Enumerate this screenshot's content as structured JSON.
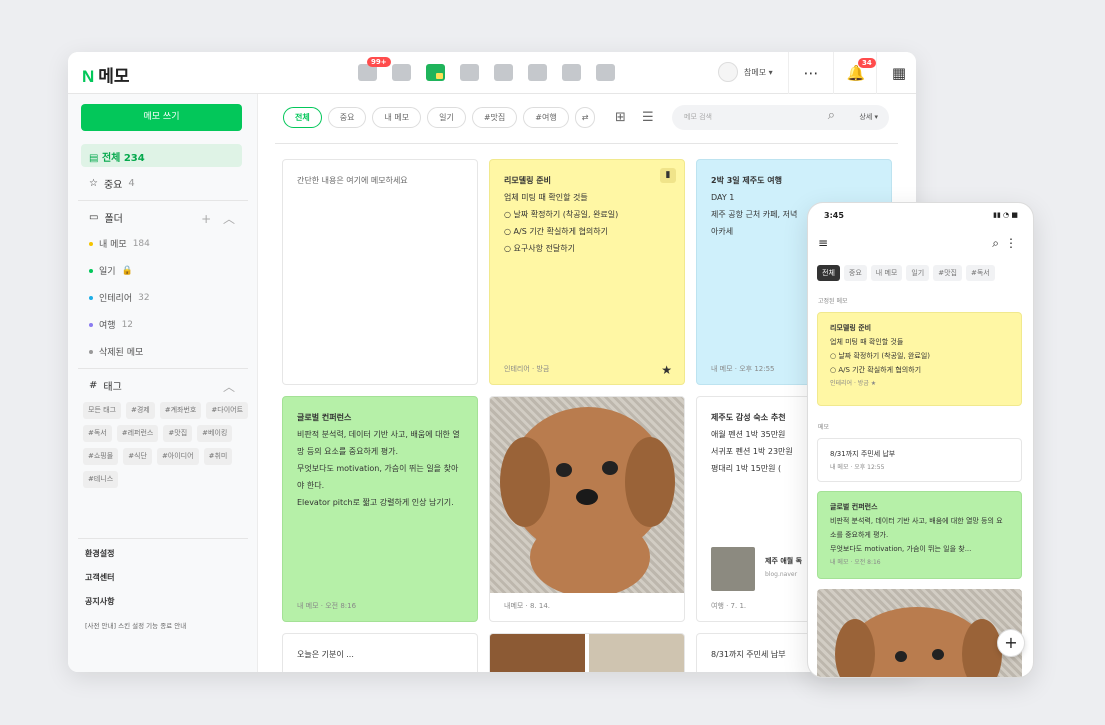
{
  "app": {
    "logo_n": "N",
    "title": "메모"
  },
  "header": {
    "mail_badge": "99+",
    "user_name": "참메모 ▾",
    "talk_icon": "⋯",
    "alarm_badge": "34",
    "grid_icon": "▦"
  },
  "sidebar": {
    "write_button": "메모 쓰기",
    "all_label": "전체 234",
    "important_label": "중요",
    "important_count": "4",
    "folder_label": "폴더",
    "folder_tools": "+ ︿",
    "folders": [
      {
        "label": "내 메모",
        "count": "184",
        "color": "#f5c400"
      },
      {
        "label": "일기",
        "count": "🔒",
        "color": "#03c75a"
      },
      {
        "label": "인테리어",
        "count": "32",
        "color": "#1eaee6"
      },
      {
        "label": "여행",
        "count": "12",
        "color": "#8b7cf0"
      },
      {
        "label": "삭제된 메모",
        "count": "",
        "color": "#999999"
      }
    ],
    "tag_label": "태그",
    "tag_toggle": "︿",
    "tags": [
      "모든 태그",
      "#경제",
      "#계좌번호",
      "#다이어트",
      "#독서",
      "#레퍼런스",
      "#맛집",
      "#베이킹",
      "#쇼핑몰",
      "#식단",
      "#아이디어",
      "#취미",
      "#테니스"
    ],
    "footer": [
      "환경설정",
      "고객센터",
      "공지사항"
    ],
    "notice": "[사전 안내] 스킨 설정 기능 종료 안내"
  },
  "filters": {
    "chips": [
      "전체",
      "중요",
      "내 메모",
      "일기",
      "#맛집",
      "#여행"
    ],
    "swap_icon": "⇄",
    "grid_view": "⊞",
    "list_view": "☰",
    "search_placeholder": "메모 검색",
    "search_icon": "⌕",
    "detail_label": "상세 ▾"
  },
  "cards": {
    "quick": {
      "placeholder": "간단한 내용은 여기에 메모하세요"
    },
    "remodel": {
      "title": "리모델링 준비",
      "subtitle": "업체 미팅 때 확인할 것들",
      "items": [
        "날짜 확정하기 (착공일, 완료일)",
        "A/S 기간 확실하게 협의하기",
        "요구사항 전달하기"
      ],
      "meta": "인테리어 · 방금",
      "star": "★",
      "pin": "▮"
    },
    "jeju": {
      "title": "2박 3일 제주도 여행",
      "line1": "DAY 1",
      "line2": "제주 공항 근처 카페, 저녁",
      "line3": "아카세",
      "meta": "내 메모 · 오후 12:55"
    },
    "global": {
      "title": "글로벌 컨퍼런스",
      "body": "비판적 분석력, 데이터 기반 사고, 배움에 대한 열망 등의 요소를 중요하게 평가.",
      "body2": "무엇보다도 motivation, 가슴이 뛰는 일을 찾아야 한다.",
      "body3": "Elevator pitch로 짧고 강렬하게 인상 남기기.",
      "meta": "내 메모 · 오전 8:16"
    },
    "dog": {
      "meta": "내메모 · 8. 14."
    },
    "stay": {
      "title": "제주도 감성 숙소 추천",
      "line1": "애월 펜션 1박 35만원",
      "line2": "서귀포 펜션 1박 23만원",
      "line3": "평대리 1박 15만원 (",
      "link_title": "제주 애월 독",
      "link_url": "blog.naver",
      "meta": "여행 · 7. 1."
    },
    "mood": {
      "text": "오늘은 기분이 ..."
    },
    "resident": {
      "text": "8/31까지 주민세 납부"
    }
  },
  "phone": {
    "time": "3:45",
    "status": "▮▮ ◔ ■",
    "menu_icon": "≡",
    "search_icon": "⌕",
    "more_icon": "⋮",
    "chips": [
      "전체",
      "중요",
      "내 메모",
      "일기",
      "#맛집",
      "#독서"
    ],
    "pinned_label": "고정된 메모",
    "memo_label": "메모",
    "remodel": {
      "title": "리모델링 준비",
      "subtitle": "업체 미팅 때 확인할 것들",
      "items": [
        "날짜 확정하기 (착공일, 완료일)",
        "A/S 기간 확실하게 협의하기"
      ],
      "meta": "인테리어 · 방금 ★"
    },
    "resident": {
      "title": "8/31까지 주민세 납부",
      "meta": "내 메모 · 오후 12:55"
    },
    "global": {
      "title": "글로벌 컨퍼런스",
      "body": "비판적 분석력, 데이터 기반 사고, 배움에 대한 열망 등의 요소를 중요하게 평가.",
      "body2": "무엇보다도 motivation, 가슴이 뛰는 일을 찾...",
      "meta": "내 메모 · 오전 8:16"
    },
    "fab": "+"
  }
}
